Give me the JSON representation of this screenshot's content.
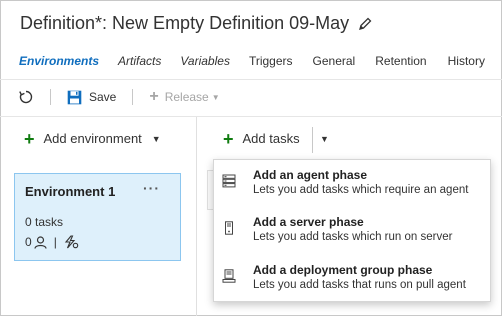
{
  "header": {
    "title": "Definition*: New Empty Definition 09-May",
    "edit_icon": "pencil-icon"
  },
  "tabs": [
    {
      "label": "Environments",
      "active": true
    },
    {
      "label": "Artifacts"
    },
    {
      "label": "Variables"
    },
    {
      "label": "Triggers"
    },
    {
      "label": "General"
    },
    {
      "label": "Retention"
    },
    {
      "label": "History"
    }
  ],
  "toolbar": {
    "refresh_icon": "refresh-icon",
    "save_label": "Save",
    "save_icon": "save-icon",
    "release_label": "Release"
  },
  "environments_panel": {
    "add_environment_label": "Add environment",
    "environment": {
      "name": "Environment 1",
      "more_label": "···",
      "tasks_label": "0 tasks",
      "approvers_count": "0",
      "separator": "|"
    }
  },
  "tasks_panel": {
    "add_tasks_label": "Add tasks",
    "menu": [
      {
        "title": "Add an agent phase",
        "description": "Lets you add tasks which require an agent",
        "icon": "agent-phase-icon"
      },
      {
        "title": "Add a server phase",
        "description": "Lets you add tasks which run on server",
        "icon": "server-phase-icon"
      },
      {
        "title": "Add a deployment group phase",
        "description": "Lets you add tasks that runs on pull agent",
        "icon": "deployment-group-icon"
      }
    ]
  },
  "colors": {
    "accent": "#106ebe",
    "add_green": "#107c10",
    "card_bg": "#def0fb",
    "card_border": "#8cc6ef"
  }
}
